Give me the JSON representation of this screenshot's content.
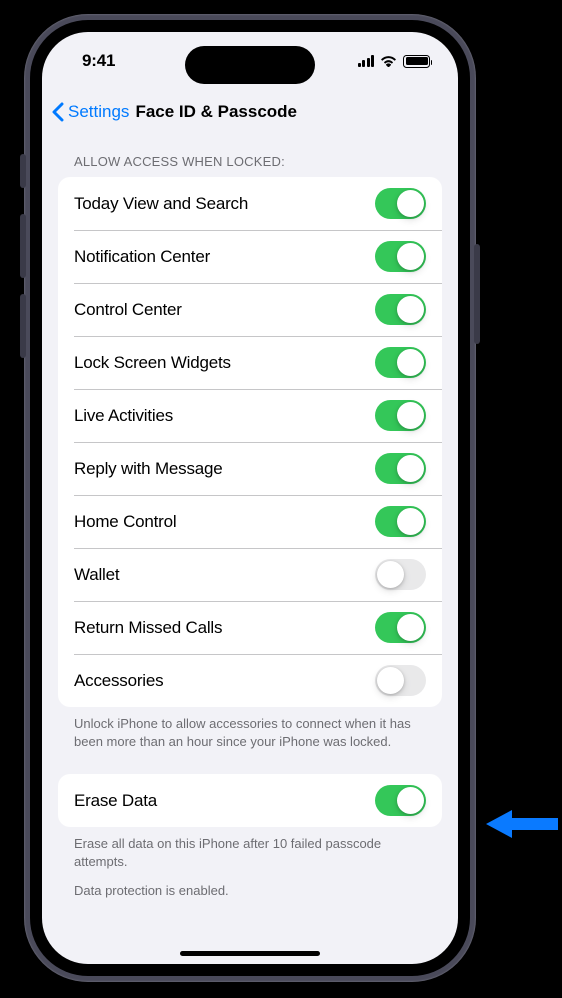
{
  "status": {
    "time": "9:41"
  },
  "nav": {
    "back_label": "Settings",
    "title": "Face ID & Passcode"
  },
  "allow_access": {
    "header": "Allow Access When Locked:",
    "items": [
      {
        "label": "Today View and Search",
        "on": true
      },
      {
        "label": "Notification Center",
        "on": true
      },
      {
        "label": "Control Center",
        "on": true
      },
      {
        "label": "Lock Screen Widgets",
        "on": true
      },
      {
        "label": "Live Activities",
        "on": true
      },
      {
        "label": "Reply with Message",
        "on": true
      },
      {
        "label": "Home Control",
        "on": true
      },
      {
        "label": "Wallet",
        "on": false
      },
      {
        "label": "Return Missed Calls",
        "on": true
      },
      {
        "label": "Accessories",
        "on": false
      }
    ],
    "footer": "Unlock iPhone to allow accessories to connect when it has been more than an hour since your iPhone was locked."
  },
  "erase": {
    "label": "Erase Data",
    "on": true,
    "footer1": "Erase all data on this iPhone after 10 failed passcode attempts.",
    "footer2": "Data protection is enabled."
  },
  "colors": {
    "accent": "#007aff",
    "toggle_on": "#34c759"
  }
}
